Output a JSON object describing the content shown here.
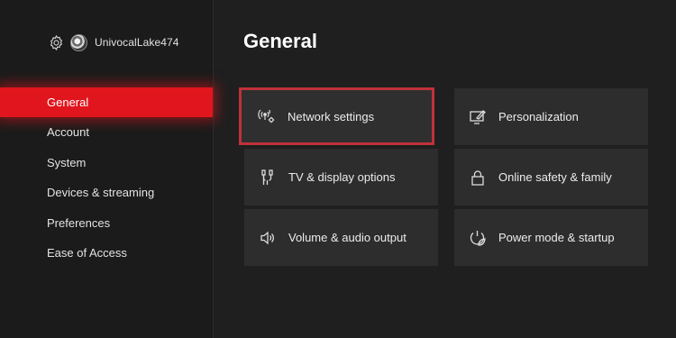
{
  "profile": {
    "username": "UnivocalLake474",
    "settings_icon": "gear-icon",
    "avatar_icon": "avatar"
  },
  "sidebar": {
    "items": [
      {
        "label": "General",
        "active": true
      },
      {
        "label": "Account",
        "active": false
      },
      {
        "label": "System",
        "active": false
      },
      {
        "label": "Devices & streaming",
        "active": false
      },
      {
        "label": "Preferences",
        "active": false
      },
      {
        "label": "Ease of Access",
        "active": false
      }
    ]
  },
  "main": {
    "title": "General",
    "tiles": [
      {
        "label": "Network settings",
        "icon": "network-icon",
        "focused": true
      },
      {
        "label": "TV & display options",
        "icon": "hdmi-cable-icon",
        "focused": false
      },
      {
        "label": "Volume & audio output",
        "icon": "speaker-icon",
        "focused": false
      },
      {
        "label": "Personalization",
        "icon": "paint-monitor-icon",
        "focused": false
      },
      {
        "label": "Online safety & family",
        "icon": "lock-icon",
        "focused": false
      },
      {
        "label": "Power mode & startup",
        "icon": "power-leaf-icon",
        "focused": false
      }
    ]
  },
  "colors": {
    "accent": "#e1151d",
    "focus_outline": "#c0313a",
    "background": "#1f1f1f",
    "tile": "#2d2d2d"
  }
}
